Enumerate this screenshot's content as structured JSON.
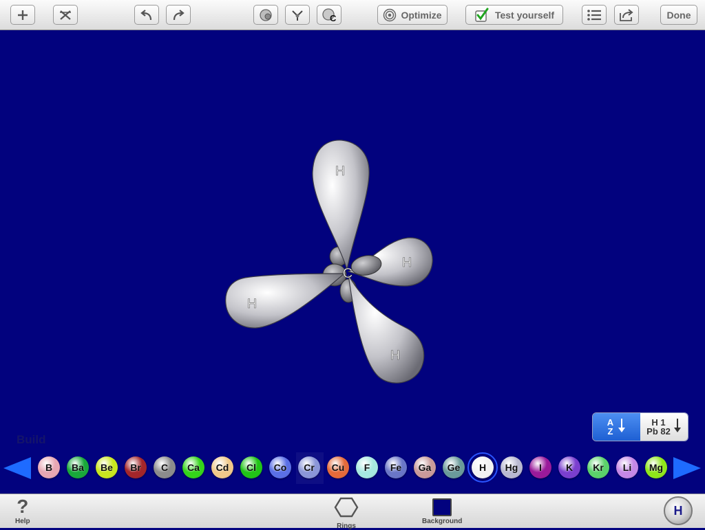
{
  "toolbar": {
    "add_icon": "plus-icon",
    "delete_icon": "x-icon",
    "undo_icon": "undo-icon",
    "redo_icon": "redo-icon",
    "tool1_icon": "atom-icon",
    "tool2_icon": "bond-split-icon",
    "tool3_icon": "carbon-icon",
    "tool3_letter": "C",
    "optimize_label": "Optimize",
    "test_label": "Test yourself",
    "list_icon": "list-icon",
    "share_icon": "share-icon",
    "done_label": "Done"
  },
  "molecule": {
    "center": "C",
    "atoms": [
      "H",
      "H",
      "H",
      "H"
    ]
  },
  "mode_label": "Build",
  "sort": {
    "az_top": "A",
    "az_bottom": "Z",
    "num_top": "H 1",
    "num_bottom": "Pb 82"
  },
  "elements": [
    {
      "symbol": "B",
      "color": "#e8a7b3"
    },
    {
      "symbol": "Ba",
      "color": "#19a83a"
    },
    {
      "symbol": "Be",
      "color": "#c9e61f"
    },
    {
      "symbol": "Br",
      "color": "#a3262a"
    },
    {
      "symbol": "C",
      "color": "#8c8c8c"
    },
    {
      "symbol": "Ca",
      "color": "#34d41a"
    },
    {
      "symbol": "Cd",
      "color": "#f0c98a"
    },
    {
      "symbol": "Cl",
      "color": "#21c417"
    },
    {
      "symbol": "Co",
      "color": "#5a6fe6"
    },
    {
      "symbol": "Cr",
      "color": "#8a96d8"
    },
    {
      "symbol": "Cu",
      "color": "#e46a3a"
    },
    {
      "symbol": "F",
      "color": "#a6e8e0"
    },
    {
      "symbol": "Fe",
      "color": "#6a76c7"
    },
    {
      "symbol": "Ga",
      "color": "#c99a9a"
    },
    {
      "symbol": "Ge",
      "color": "#6a9a9a"
    },
    {
      "symbol": "H",
      "color": "#f2f2f2"
    },
    {
      "symbol": "Hg",
      "color": "#b9b9d1"
    },
    {
      "symbol": "I",
      "color": "#9a1a9a"
    },
    {
      "symbol": "K",
      "color": "#7b3fcf"
    },
    {
      "symbol": "Kr",
      "color": "#5bd16a"
    },
    {
      "symbol": "Li",
      "color": "#c588e6"
    },
    {
      "symbol": "Mg",
      "color": "#8fe61a"
    }
  ],
  "selected_element": "H",
  "bottom": {
    "help_label": "Help",
    "rings_label": "Rings",
    "background_label": "Background",
    "background_color": "#02027e",
    "current_element": "H"
  }
}
